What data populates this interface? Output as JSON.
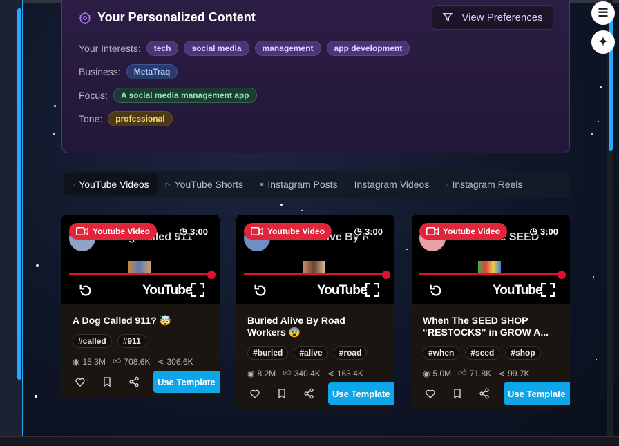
{
  "prefs": {
    "title": "Your Personalized Content",
    "view_button": "View Preferences",
    "interests_label": "Your Interests:",
    "interests": [
      "tech",
      "social media",
      "management",
      "app development"
    ],
    "business_label": "Business:",
    "business": "MetaTraq",
    "focus_label": "Focus:",
    "focus": "A social media management app",
    "tone_label": "Tone:",
    "tone": "professional"
  },
  "tabs": [
    "YouTube Videos",
    "YouTube Shorts",
    "Instagram Posts",
    "Instagram Videos",
    "Instagram Reels"
  ],
  "colors": {
    "accent": "#0ea5e9",
    "youtube_red": "#e0263b",
    "panel": "#2a1c40"
  },
  "cards": [
    {
      "badge": "Youtube Video",
      "duration": "3:00",
      "thumb_title": "A Dog Called 911?...",
      "yt_logo": "YouTube",
      "title": "A Dog Called 911? 🤯",
      "tags": [
        "#called",
        "#911"
      ],
      "views": "15.3M",
      "likes": "708.6K",
      "shares": "306.6K",
      "cta": "Use Template"
    },
    {
      "badge": "Youtube Video",
      "duration": "3:00",
      "thumb_title": "Buried Alive By R...",
      "yt_logo": "YouTube",
      "title": "Buried Alive By Road Workers 😨",
      "tags": [
        "#buried",
        "#alive",
        "#road"
      ],
      "views": "8.2M",
      "likes": "340.4K",
      "shares": "163.4K",
      "cta": "Use Template"
    },
    {
      "badge": "Youtube Video",
      "duration": "3:00",
      "thumb_title": "When The SEED S...",
      "yt_logo": "YouTube",
      "title": "When The SEED SHOP “RESTOCKS” in GROW A...",
      "tags": [
        "#when",
        "#seed",
        "#shop"
      ],
      "views": "5.0M",
      "likes": "71.8K",
      "shares": "99.7K",
      "cta": "Use Template"
    }
  ]
}
